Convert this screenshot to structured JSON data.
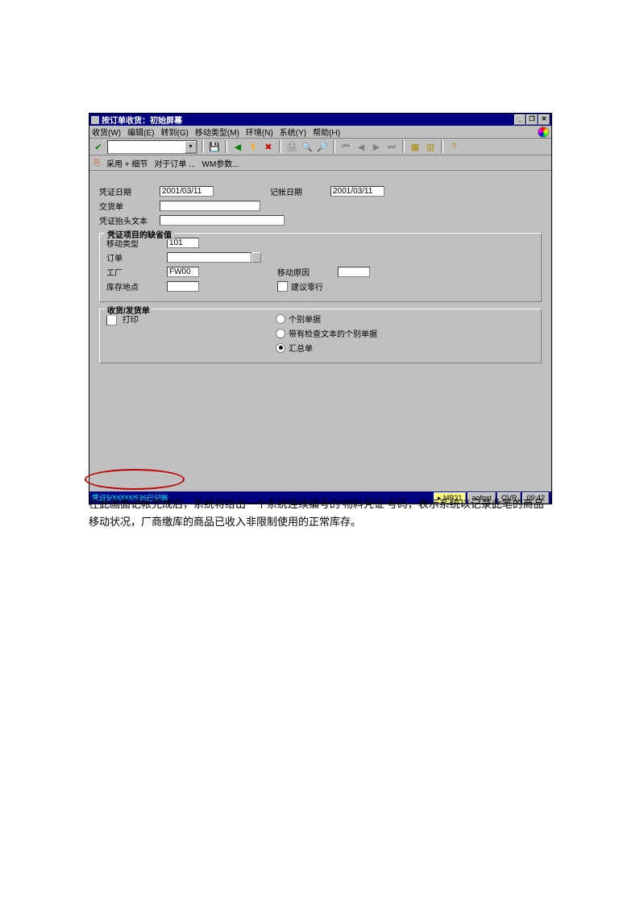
{
  "window": {
    "title": "按订单收货：初始屏幕"
  },
  "menubar": {
    "items": [
      "收货(W)",
      "编辑(E)",
      "转到(G)",
      "移动类型(M)",
      "环境(N)",
      "系统(Y)",
      "帮助(H)"
    ]
  },
  "subtoolbar": {
    "items": [
      "采用 + 细节",
      "对于订单 ...",
      "WM参数..."
    ]
  },
  "fields": {
    "voucher_date_label": "凭证日期",
    "voucher_date_value": "2001/03/11",
    "posting_date_label": "记帐日期",
    "posting_date_value": "2001/03/11",
    "delivery_note_label": "交货单",
    "header_text_label": "凭证抬头文本"
  },
  "defaults": {
    "group_title": "凭证项目的缺省值",
    "movement_type_label": "移动类型",
    "movement_type_value": "101",
    "order_label": "订单",
    "plant_label": "工厂",
    "plant_value": "FW00",
    "storage_loc_label": "库存地点",
    "movement_reason_label": "移动原因",
    "suggest_zero_label": "建议零行"
  },
  "receipt_issue": {
    "group_title": "收货/发货单",
    "print_label": "打印",
    "radio_individual": "个别单据",
    "radio_with_text": "带有检查文本的个别单据",
    "radio_summary": "汇总单"
  },
  "status": {
    "message": "凭证5000000536已记帐",
    "tcode": "MB31",
    "client": "aofqst",
    "mode": "OVR",
    "time": "09:42"
  },
  "caption": "在此画面记帐完成后，系统将给出一个系统连续编号的‘物料凭证’号码，表示系统以记录此笔的商品移动状况，厂商缴库的商品已收入非限制使用的正常库存。"
}
